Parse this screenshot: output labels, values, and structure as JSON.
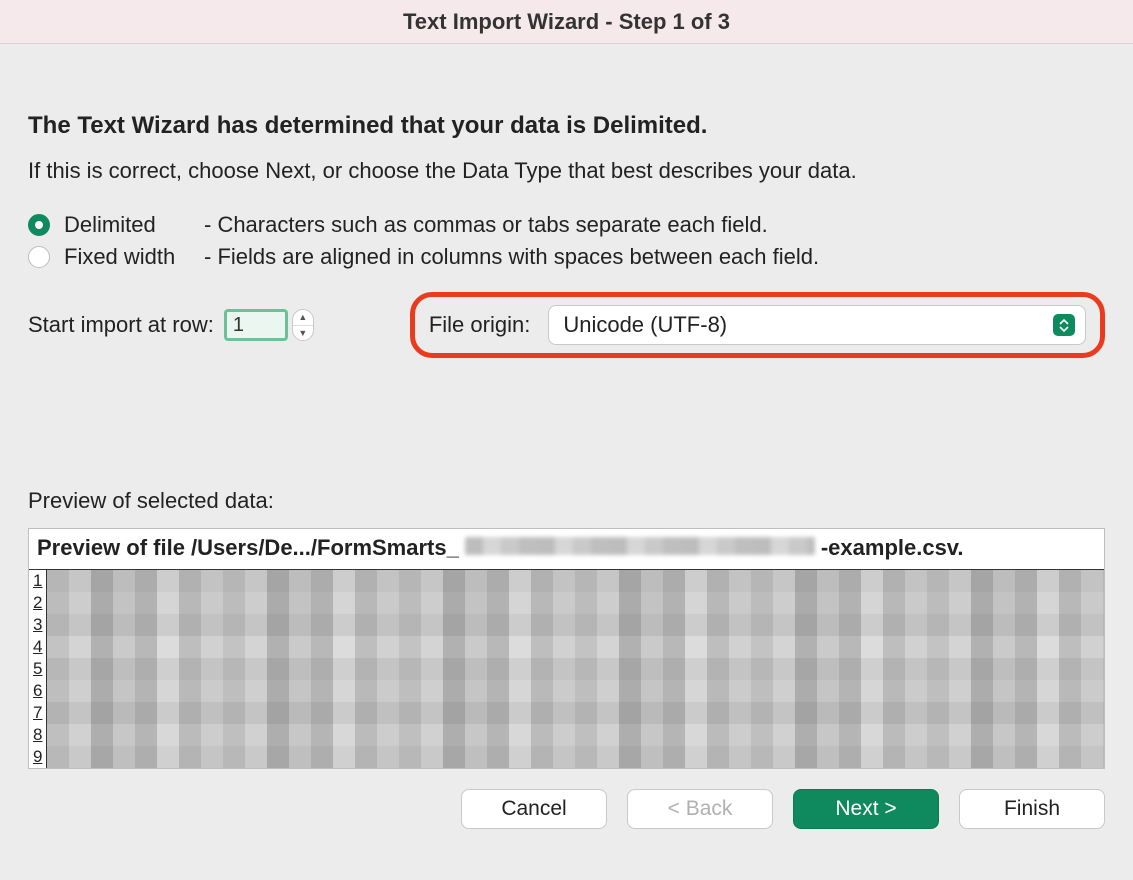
{
  "title": "Text Import Wizard - Step 1 of 3",
  "heading": "The Text Wizard has determined that your data is Delimited.",
  "subheading": "If this is correct, choose Next, or choose the Data Type that best describes your data.",
  "options": {
    "delimited": {
      "label": "Delimited",
      "desc": "- Characters such as commas or tabs separate each field."
    },
    "fixed": {
      "label": "Fixed width",
      "desc": "- Fields are aligned in columns with spaces between each field."
    }
  },
  "start_row": {
    "label": "Start import at row:",
    "value": "1"
  },
  "file_origin": {
    "label": "File origin:",
    "value": "Unicode (UTF-8)"
  },
  "preview": {
    "label": "Preview of selected data:",
    "file_prefix": "Preview of file /Users/De.../FormSmarts_",
    "file_suffix": "-example.csv.",
    "rows": [
      "1",
      "2",
      "3",
      "4",
      "5",
      "6",
      "7",
      "8",
      "9"
    ]
  },
  "buttons": {
    "cancel": "Cancel",
    "back": "< Back",
    "next": "Next >",
    "finish": "Finish"
  }
}
